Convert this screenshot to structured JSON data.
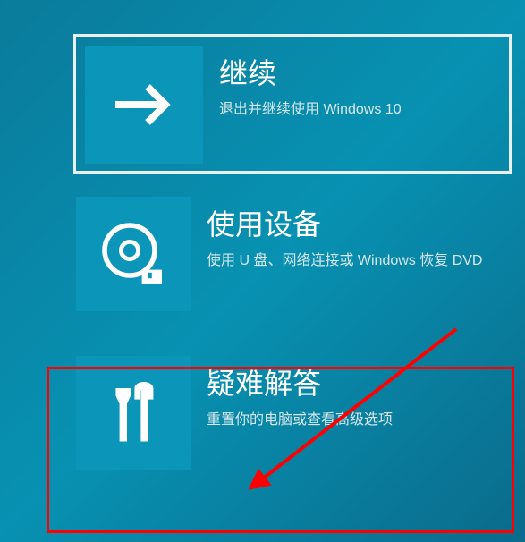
{
  "options": [
    {
      "title": "继续",
      "description": "退出并继续使用 Windows 10"
    },
    {
      "title": "使用设备",
      "description": "使用 U 盘、网络连接或 Windows 恢复 DVD"
    },
    {
      "title": "疑难解答",
      "description": "重置你的电脑或查看高级选项"
    }
  ]
}
